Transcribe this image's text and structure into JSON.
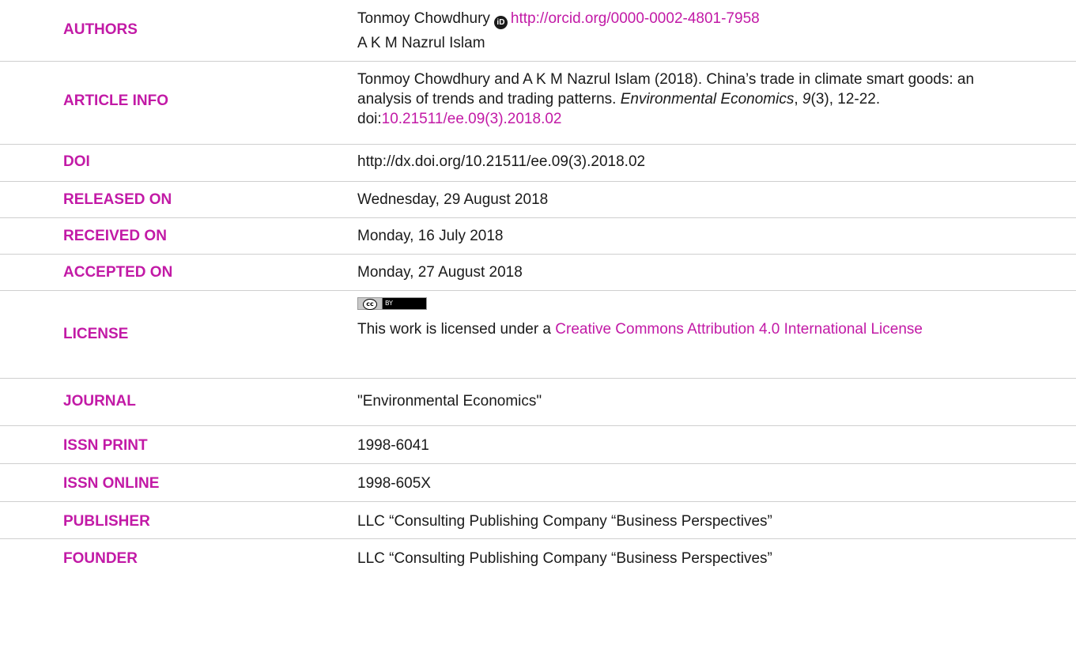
{
  "rows": {
    "authors": {
      "label": "AUTHORS",
      "author1_name": "Tonmoy Chowdhury",
      "orcid_icon_text": "iD",
      "author1_orcid": "http://orcid.org/0000-0002-4801-7958",
      "author2_name": "A K M Nazrul Islam"
    },
    "article_info": {
      "label": "ARTICLE INFO",
      "citation_prefix": "Tonmoy Chowdhury and A K M Nazrul Islam (2018). China’s trade in climate smart goods: an analysis of trends and trading patterns. ",
      "journal_italic": "Environmental Economics",
      "sep1": ", ",
      "volume_italic": "9",
      "issue_pages": "(3), 12-22. doi:",
      "doi_link": "10.21511/ee.09(3).2018.02"
    },
    "doi": {
      "label": "DOI",
      "value": "http://dx.doi.org/10.21511/ee.09(3).2018.02"
    },
    "released_on": {
      "label": "RELEASED ON",
      "value": "Wednesday, 29 August 2018"
    },
    "received_on": {
      "label": "RECEIVED ON",
      "value": "Monday, 16 July 2018"
    },
    "accepted_on": {
      "label": "ACCEPTED ON",
      "value": "Monday, 27 August 2018"
    },
    "license": {
      "label": "LICENSE",
      "badge_cc": "cc",
      "badge_by": "BY",
      "text_prefix": "This work is licensed under a ",
      "link_text": "Creative Commons Attribution 4.0 International License"
    },
    "journal": {
      "label": "JOURNAL",
      "value": "\"Environmental Economics\""
    },
    "issn_print": {
      "label": "ISSN PRINT",
      "value": "1998-6041"
    },
    "issn_online": {
      "label": "ISSN ONLINE",
      "value": "1998-605X"
    },
    "publisher": {
      "label": "PUBLISHER",
      "value": "LLC “Consulting Publishing Company “Business Perspectives”"
    },
    "founder": {
      "label": "FOUNDER",
      "value": "LLC “Consulting Publishing Company “Business Perspectives”"
    }
  },
  "colors": {
    "label": "#c21aa6",
    "link": "#c21aa6",
    "text": "#1a1a1a",
    "divider": "#cfcfcf"
  }
}
